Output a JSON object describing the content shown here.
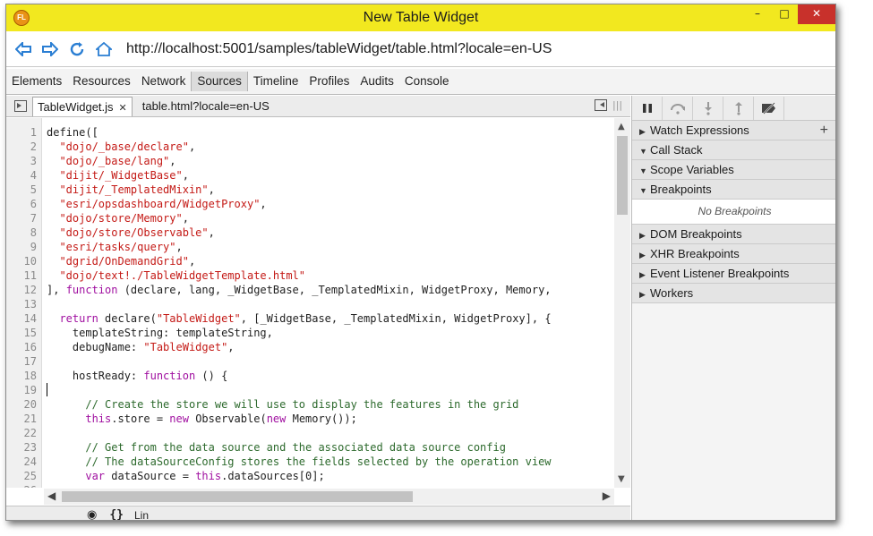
{
  "window": {
    "title": "New Table Widget",
    "app_logo": "flame-logo-icon",
    "controls": [
      "minimize",
      "maximize",
      "close"
    ]
  },
  "addressbar": {
    "back_icon": "back-arrow-icon",
    "forward_icon": "forward-arrow-icon",
    "refresh_icon": "refresh-icon",
    "home_icon": "home-icon",
    "url": "http://localhost:5001/samples/tableWidget/table.html?locale=en-US"
  },
  "devtools": {
    "tabs": [
      "Elements",
      "Resources",
      "Network",
      "Sources",
      "Timeline",
      "Profiles",
      "Audits",
      "Console"
    ],
    "active_tab": "Sources"
  },
  "editor": {
    "tabs": [
      {
        "label": "TableWidget.js",
        "active": true,
        "closable": true
      },
      {
        "label": "table.html?locale=en-US",
        "active": false,
        "closable": false
      }
    ],
    "lines": [
      {
        "n": "1",
        "segments": [
          {
            "t": "define([",
            "c": ""
          }
        ]
      },
      {
        "n": "2",
        "segments": [
          {
            "t": "  ",
            "c": ""
          },
          {
            "t": "\"dojo/_base/declare\"",
            "c": "str"
          },
          {
            "t": ",",
            "c": ""
          }
        ]
      },
      {
        "n": "3",
        "segments": [
          {
            "t": "  ",
            "c": ""
          },
          {
            "t": "\"dojo/_base/lang\"",
            "c": "str"
          },
          {
            "t": ",",
            "c": ""
          }
        ]
      },
      {
        "n": "4",
        "segments": [
          {
            "t": "  ",
            "c": ""
          },
          {
            "t": "\"dijit/_WidgetBase\"",
            "c": "str"
          },
          {
            "t": ",",
            "c": ""
          }
        ]
      },
      {
        "n": "5",
        "segments": [
          {
            "t": "  ",
            "c": ""
          },
          {
            "t": "\"dijit/_TemplatedMixin\"",
            "c": "str"
          },
          {
            "t": ",",
            "c": ""
          }
        ]
      },
      {
        "n": "6",
        "segments": [
          {
            "t": "  ",
            "c": ""
          },
          {
            "t": "\"esri/opsdashboard/WidgetProxy\"",
            "c": "str"
          },
          {
            "t": ",",
            "c": ""
          }
        ]
      },
      {
        "n": "7",
        "segments": [
          {
            "t": "  ",
            "c": ""
          },
          {
            "t": "\"dojo/store/Memory\"",
            "c": "str"
          },
          {
            "t": ",",
            "c": ""
          }
        ]
      },
      {
        "n": "8",
        "segments": [
          {
            "t": "  ",
            "c": ""
          },
          {
            "t": "\"dojo/store/Observable\"",
            "c": "str"
          },
          {
            "t": ",",
            "c": ""
          }
        ]
      },
      {
        "n": "9",
        "segments": [
          {
            "t": "  ",
            "c": ""
          },
          {
            "t": "\"esri/tasks/query\"",
            "c": "str"
          },
          {
            "t": ",",
            "c": ""
          }
        ]
      },
      {
        "n": "10",
        "segments": [
          {
            "t": "  ",
            "c": ""
          },
          {
            "t": "\"dgrid/OnDemandGrid\"",
            "c": "str"
          },
          {
            "t": ",",
            "c": ""
          }
        ]
      },
      {
        "n": "11",
        "segments": [
          {
            "t": "  ",
            "c": ""
          },
          {
            "t": "\"dojo/text!./TableWidgetTemplate.html\"",
            "c": "str"
          }
        ]
      },
      {
        "n": "12",
        "segments": [
          {
            "t": "], ",
            "c": ""
          },
          {
            "t": "function",
            "c": "kw"
          },
          {
            "t": " (declare, lang, _WidgetBase, _TemplatedMixin, WidgetProxy, Memory,",
            "c": ""
          }
        ]
      },
      {
        "n": "13",
        "segments": []
      },
      {
        "n": "14",
        "segments": [
          {
            "t": "  ",
            "c": ""
          },
          {
            "t": "return",
            "c": "kw"
          },
          {
            "t": " declare(",
            "c": ""
          },
          {
            "t": "\"TableWidget\"",
            "c": "str"
          },
          {
            "t": ", [_WidgetBase, _TemplatedMixin, WidgetProxy], {",
            "c": ""
          }
        ]
      },
      {
        "n": "15",
        "segments": [
          {
            "t": "    templateString: templateString,",
            "c": ""
          }
        ]
      },
      {
        "n": "16",
        "segments": [
          {
            "t": "    debugName: ",
            "c": ""
          },
          {
            "t": "\"TableWidget\"",
            "c": "str"
          },
          {
            "t": ",",
            "c": ""
          }
        ]
      },
      {
        "n": "17",
        "segments": []
      },
      {
        "n": "18",
        "segments": [
          {
            "t": "    hostReady: ",
            "c": ""
          },
          {
            "t": "function",
            "c": "kw"
          },
          {
            "t": " () {",
            "c": ""
          }
        ]
      },
      {
        "n": "19",
        "segments": [],
        "caret": true
      },
      {
        "n": "20",
        "segments": [
          {
            "t": "      ",
            "c": ""
          },
          {
            "t": "// Create the store we will use to display the features in the grid",
            "c": "cm"
          }
        ]
      },
      {
        "n": "21",
        "segments": [
          {
            "t": "      ",
            "c": ""
          },
          {
            "t": "this",
            "c": "kw"
          },
          {
            "t": ".store = ",
            "c": ""
          },
          {
            "t": "new",
            "c": "kw"
          },
          {
            "t": " Observable(",
            "c": ""
          },
          {
            "t": "new",
            "c": "kw"
          },
          {
            "t": " Memory());",
            "c": ""
          }
        ]
      },
      {
        "n": "22",
        "segments": []
      },
      {
        "n": "23",
        "segments": [
          {
            "t": "      ",
            "c": ""
          },
          {
            "t": "// Get from the data source and the associated data source config",
            "c": "cm"
          }
        ]
      },
      {
        "n": "24",
        "segments": [
          {
            "t": "      ",
            "c": ""
          },
          {
            "t": "// The dataSourceConfig stores the fields selected by the operation view",
            "c": "cm"
          }
        ]
      },
      {
        "n": "25",
        "segments": [
          {
            "t": "      ",
            "c": ""
          },
          {
            "t": "var",
            "c": "kw"
          },
          {
            "t": " dataSource = ",
            "c": ""
          },
          {
            "t": "this",
            "c": "kw"
          },
          {
            "t": ".dataSources[0];",
            "c": ""
          }
        ]
      },
      {
        "n": "26",
        "segments": []
      }
    ]
  },
  "statusbar": {
    "pretty_print": "{}",
    "line_label": "Lin"
  },
  "debugger": {
    "toolbar_icons": [
      "pause-icon",
      "step-over-icon",
      "step-into-icon",
      "step-out-icon",
      "deactivate-breakpoints-icon"
    ],
    "sections": [
      {
        "label": "Watch Expressions",
        "expanded": false,
        "add": true
      },
      {
        "label": "Call Stack",
        "expanded": true
      },
      {
        "label": "Scope Variables",
        "expanded": true
      },
      {
        "label": "Breakpoints",
        "expanded": true,
        "empty_text": "No Breakpoints"
      },
      {
        "label": "DOM Breakpoints",
        "expanded": false
      },
      {
        "label": "XHR Breakpoints",
        "expanded": false
      },
      {
        "label": "Event Listener Breakpoints",
        "expanded": false
      },
      {
        "label": "Workers",
        "expanded": false
      }
    ]
  },
  "colors": {
    "titlebar": "#f2e81f",
    "close_button": "#c8312b",
    "string": "#c41a16",
    "keyword": "#a00fa0",
    "comment": "#2d6a2d",
    "nav_icon": "#2a7ed3"
  }
}
